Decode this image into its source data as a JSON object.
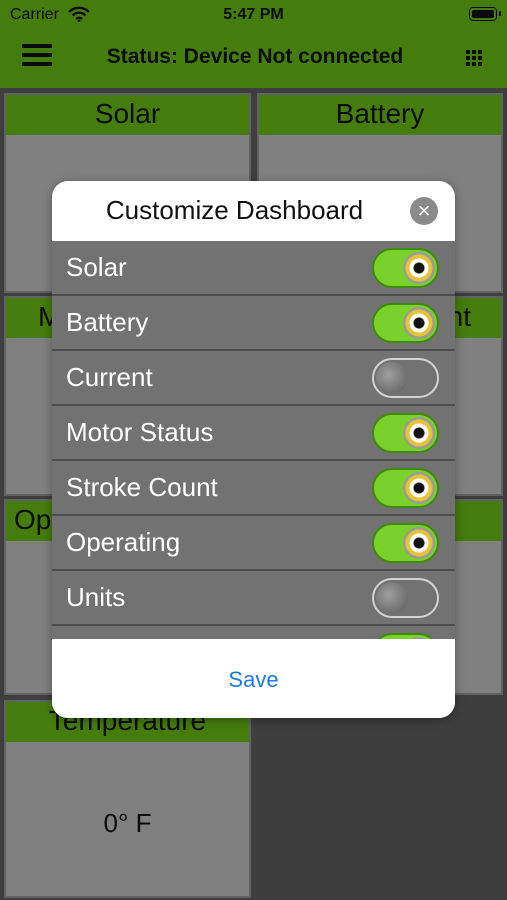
{
  "status_bar": {
    "carrier": "Carrier",
    "time": "5:47 PM"
  },
  "nav": {
    "title": "Status: Device Not connected",
    "menu_icon": "hamburger-icon",
    "grid_icon": "grid-icon"
  },
  "colors": {
    "accent": "#66b812",
    "tile_bg": "#bdbdbd",
    "toggle_on": "#7bd12b",
    "link": "#1b7be8"
  },
  "tiles": {
    "solar": {
      "label": "Solar"
    },
    "battery": {
      "label": "Battery"
    },
    "motor_status": {
      "label": "M"
    },
    "current": {
      "label": "nt"
    },
    "operating": {
      "label": "Op"
    },
    "temperature": {
      "label": "Temperature",
      "value": "0° F"
    }
  },
  "modal": {
    "title": "Customize Dashboard",
    "close_icon": "close-icon",
    "save_label": "Save",
    "items": [
      {
        "label": "Solar",
        "enabled": true
      },
      {
        "label": "Battery",
        "enabled": true
      },
      {
        "label": "Current",
        "enabled": false
      },
      {
        "label": "Motor Status",
        "enabled": true
      },
      {
        "label": "Stroke Count",
        "enabled": true
      },
      {
        "label": "Operating",
        "enabled": true
      },
      {
        "label": "Units",
        "enabled": false
      },
      {
        "label": "",
        "enabled": true
      }
    ]
  }
}
